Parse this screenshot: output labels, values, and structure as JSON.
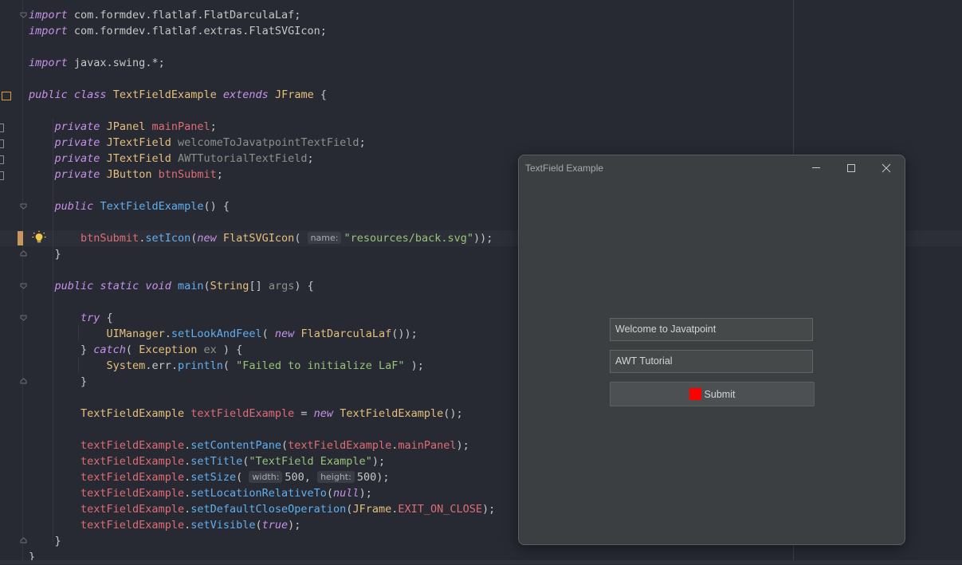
{
  "editor": {
    "lines": [
      [
        [
          "kw",
          "import"
        ],
        [
          "df",
          " com.formdev.flatlaf.FlatDarculaLaf;"
        ]
      ],
      [
        [
          "kw",
          "import"
        ],
        [
          "df",
          " com.formdev.flatlaf.extras.FlatSVGIcon;"
        ]
      ],
      [],
      [
        [
          "kw",
          "import"
        ],
        [
          "df",
          " javax.swing.*;"
        ]
      ],
      [],
      [
        [
          "kw",
          "public"
        ],
        [
          "df",
          " "
        ],
        [
          "kw",
          "class"
        ],
        [
          "df",
          " "
        ],
        [
          "ty",
          "TextFieldExample"
        ],
        [
          "df",
          " "
        ],
        [
          "kw",
          "extends"
        ],
        [
          "df",
          " "
        ],
        [
          "ty",
          "JFrame"
        ],
        [
          "df",
          " {"
        ]
      ],
      [],
      [
        [
          "df",
          "    "
        ],
        [
          "kw",
          "private"
        ],
        [
          "df",
          " "
        ],
        [
          "ty",
          "JPanel"
        ],
        [
          "df",
          " "
        ],
        [
          "fd",
          "mainPanel"
        ],
        [
          "df",
          ";"
        ]
      ],
      [
        [
          "df",
          "    "
        ],
        [
          "kw",
          "private"
        ],
        [
          "df",
          " "
        ],
        [
          "ty",
          "JTextField"
        ],
        [
          "df",
          " "
        ],
        [
          "pm",
          "welcomeToJavatpointTextField"
        ],
        [
          "df",
          ";"
        ]
      ],
      [
        [
          "df",
          "    "
        ],
        [
          "kw",
          "private"
        ],
        [
          "df",
          " "
        ],
        [
          "ty",
          "JTextField"
        ],
        [
          "df",
          " "
        ],
        [
          "pm",
          "AWTTutorialTextField"
        ],
        [
          "df",
          ";"
        ]
      ],
      [
        [
          "df",
          "    "
        ],
        [
          "kw",
          "private"
        ],
        [
          "df",
          " "
        ],
        [
          "ty",
          "JButton"
        ],
        [
          "df",
          " "
        ],
        [
          "fd",
          "btnSubmit"
        ],
        [
          "df",
          ";"
        ]
      ],
      [],
      [
        [
          "df",
          "    "
        ],
        [
          "kw",
          "public"
        ],
        [
          "df",
          " "
        ],
        [
          "fn",
          "TextFieldExample"
        ],
        [
          "df",
          "() {"
        ]
      ],
      [],
      [
        [
          "df",
          "        "
        ],
        [
          "fd",
          "btnSubmit"
        ],
        [
          "df",
          "."
        ],
        [
          "fn",
          "setIcon"
        ],
        [
          "df",
          "("
        ],
        [
          "kw",
          "new"
        ],
        [
          "df",
          " "
        ],
        [
          "ty",
          "FlatSVGIcon"
        ],
        [
          "df",
          "( "
        ],
        [
          "hint",
          "name:"
        ],
        [
          "st",
          "\"resources/back.svg\""
        ],
        [
          "df",
          "));"
        ]
      ],
      [
        [
          "df",
          "    }"
        ]
      ],
      [],
      [
        [
          "df",
          "    "
        ],
        [
          "kw",
          "public"
        ],
        [
          "df",
          " "
        ],
        [
          "kw",
          "static"
        ],
        [
          "df",
          " "
        ],
        [
          "kw",
          "void"
        ],
        [
          "df",
          " "
        ],
        [
          "fn",
          "main"
        ],
        [
          "df",
          "("
        ],
        [
          "ty",
          "String"
        ],
        [
          "df",
          "[] "
        ],
        [
          "pm",
          "args"
        ],
        [
          "df",
          ") {"
        ]
      ],
      [],
      [
        [
          "df",
          "        "
        ],
        [
          "kw",
          "try"
        ],
        [
          "df",
          " {"
        ]
      ],
      [
        [
          "df",
          "            "
        ],
        [
          "ty",
          "UIManager"
        ],
        [
          "df",
          "."
        ],
        [
          "fn",
          "setLookAndFeel"
        ],
        [
          "df",
          "( "
        ],
        [
          "kw",
          "new"
        ],
        [
          "df",
          " "
        ],
        [
          "ty",
          "FlatDarculaLaf"
        ],
        [
          "df",
          "());"
        ]
      ],
      [
        [
          "df",
          "        } "
        ],
        [
          "kw",
          "catch"
        ],
        [
          "df",
          "( "
        ],
        [
          "ty",
          "Exception"
        ],
        [
          "df",
          " "
        ],
        [
          "pm",
          "ex"
        ],
        [
          "df",
          " ) {"
        ]
      ],
      [
        [
          "df",
          "            "
        ],
        [
          "ty",
          "System"
        ],
        [
          "df",
          ".err."
        ],
        [
          "fn",
          "println"
        ],
        [
          "df",
          "( "
        ],
        [
          "st",
          "\"Failed to initialize LaF\""
        ],
        [
          "df",
          " );"
        ]
      ],
      [
        [
          "df",
          "        }"
        ]
      ],
      [],
      [
        [
          "df",
          "        "
        ],
        [
          "ty",
          "TextFieldExample"
        ],
        [
          "df",
          " "
        ],
        [
          "fd",
          "textFieldExample"
        ],
        [
          "df",
          " = "
        ],
        [
          "kw",
          "new"
        ],
        [
          "df",
          " "
        ],
        [
          "ty",
          "TextFieldExample"
        ],
        [
          "df",
          "();"
        ]
      ],
      [],
      [
        [
          "df",
          "        "
        ],
        [
          "fd",
          "textFieldExample"
        ],
        [
          "df",
          "."
        ],
        [
          "fn",
          "setContentPane"
        ],
        [
          "df",
          "("
        ],
        [
          "fd",
          "textFieldExample"
        ],
        [
          "df",
          "."
        ],
        [
          "fd",
          "mainPanel"
        ],
        [
          "df",
          ");"
        ]
      ],
      [
        [
          "df",
          "        "
        ],
        [
          "fd",
          "textFieldExample"
        ],
        [
          "df",
          "."
        ],
        [
          "fn",
          "setTitle"
        ],
        [
          "df",
          "("
        ],
        [
          "st",
          "\"TextField Example\""
        ],
        [
          "df",
          ");"
        ]
      ],
      [
        [
          "df",
          "        "
        ],
        [
          "fd",
          "textFieldExample"
        ],
        [
          "df",
          "."
        ],
        [
          "fn",
          "setSize"
        ],
        [
          "df",
          "( "
        ],
        [
          "hint",
          "width:"
        ],
        [
          "df",
          "500, "
        ],
        [
          "hint",
          "height:"
        ],
        [
          "df",
          "500);"
        ]
      ],
      [
        [
          "df",
          "        "
        ],
        [
          "fd",
          "textFieldExample"
        ],
        [
          "df",
          "."
        ],
        [
          "fn",
          "setLocationRelativeTo"
        ],
        [
          "df",
          "("
        ],
        [
          "kw",
          "null"
        ],
        [
          "df",
          ");"
        ]
      ],
      [
        [
          "df",
          "        "
        ],
        [
          "fd",
          "textFieldExample"
        ],
        [
          "df",
          "."
        ],
        [
          "fn",
          "setDefaultCloseOperation"
        ],
        [
          "df",
          "("
        ],
        [
          "ty",
          "JFrame"
        ],
        [
          "df",
          "."
        ],
        [
          "fd",
          "EXIT_ON_CLOSE"
        ],
        [
          "df",
          ");"
        ]
      ],
      [
        [
          "df",
          "        "
        ],
        [
          "fd",
          "textFieldExample"
        ],
        [
          "df",
          "."
        ],
        [
          "fn",
          "setVisible"
        ],
        [
          "df",
          "("
        ],
        [
          "kw",
          "true"
        ],
        [
          "df",
          ");"
        ]
      ],
      [
        [
          "df",
          "    }"
        ]
      ],
      [
        [
          "df",
          "}"
        ]
      ]
    ]
  },
  "dialog": {
    "title": "TextField Example",
    "welcome_field": "Welcome to Javatpoint",
    "awt_field": "AWT Tutorial",
    "submit_label": "Submit"
  },
  "icons": {
    "minimize": "minimize-icon",
    "maximize": "maximize-icon",
    "close": "close-icon",
    "intention": "lightbulb-icon",
    "submit": "back-icon"
  },
  "colors": {
    "editor_bg": "#272a33",
    "keyword": "#c792ea",
    "type": "#e6c07b",
    "field": "#e06c75",
    "method": "#61afef",
    "string": "#98c379",
    "submit_icon": "#ff0000"
  }
}
